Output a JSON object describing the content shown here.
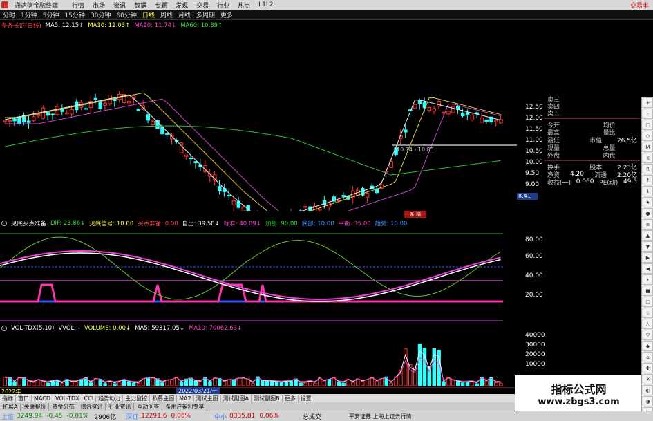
{
  "topbar": {
    "title": "通达信金融终端",
    "menus": [
      "行情",
      "市场",
      "资讯",
      "数据",
      "专题",
      "发现",
      "交易",
      "行业",
      "热点",
      "L1L2"
    ],
    "right": "交易丰"
  },
  "periods": [
    "分时",
    "1分钟",
    "5分钟",
    "15分钟",
    "30分钟",
    "60分钟",
    "日线",
    "周线",
    "月线",
    "多周期",
    "更多"
  ],
  "main_info": {
    "name": "条条长证(日线)",
    "ma5": "MA5: 12.15↓",
    "ma10": "MA10: 12.03↑",
    "ma20": "MA20: 11.74↓",
    "ma60": "MA60: 10.89↑"
  },
  "price_axis": [
    "12.50",
    "12.00",
    "11.50",
    "11.00",
    "10.50",
    "10.00",
    "9.50",
    "9.00"
  ],
  "range_label": "10.74 - 10.85",
  "cursor_price": "8.41",
  "quote": {
    "sell_labels": [
      "卖三",
      "卖四",
      "卖五"
    ],
    "rows": [
      {
        "l": "今开",
        "lv": "",
        "r": "均价",
        "rv": ""
      },
      {
        "l": "最高",
        "lv": "",
        "r": "量比",
        "rv": ""
      },
      {
        "l": "最低",
        "lv": "",
        "r": "市值",
        "rv": "26.5亿"
      },
      {
        "l": "现量",
        "lv": "",
        "r": "总量",
        "rv": ""
      },
      {
        "l": "外盘",
        "lv": "",
        "r": "内盘",
        "rv": ""
      },
      {
        "l": "换手",
        "lv": "",
        "r": "股本",
        "rv": "2.23亿"
      },
      {
        "l": "净资",
        "lv": "4.20",
        "r": "流通",
        "rv": "2.20亿"
      },
      {
        "l": "收益(一)",
        "lv": "0.060",
        "r": "PE(动)",
        "rv": "49.5"
      }
    ]
  },
  "indicator": {
    "name": "见底买点准备",
    "dif": "DIF: 23.86↓",
    "signal": "见底信号: 10.00",
    "buy": "买点准备: 0.00",
    "exit": "自出: 39.58↓",
    "a": "标准: 40.09↓",
    "b": "顶部: 90.00",
    "c": "底部: 10.00",
    "d": "平衡: 35.00",
    "e": "趋势: 10.00",
    "axis": [
      "80.00",
      "60.00",
      "40.00",
      "20.00"
    ],
    "marker": "条 精"
  },
  "volume": {
    "name": "VOL-TDX(5,10)",
    "vvol": "VVOL: -",
    "vol": "VOLUME: 0.00↓",
    "ma5": "MA5: 59317.05↓",
    "ma10": "MA10: 70062.63↓",
    "axis": [
      "40000",
      "30000",
      "20000",
      "10000"
    ],
    "date_tag": "2022/03/21/一",
    "year": "2022年"
  },
  "bottom_tabs": [
    "指标",
    "窗口",
    "MACD",
    "VOL-TDX",
    "CCI",
    "趋势动力",
    "主力监控",
    "私募主图",
    "MA2",
    "测试主图",
    "测试副图A",
    "测试副图B",
    "更多",
    "设置"
  ],
  "bottom_tabs2": [
    "扩展A",
    "关联报价",
    "资金分布",
    "综合资讯",
    "行业资讯",
    "互动问答",
    "条用户福利专享"
  ],
  "status": {
    "sh_label": "上证",
    "sh_val": "3249.94",
    "sh_chg": "-0.45",
    "sh_pct": "-0.01%",
    "sh_amt": "2906亿",
    "sz_label": "深证",
    "sz_val": "12291.6",
    "sz_pct": "0.06%",
    "zx_label": "中小",
    "zx_val": "8335.81",
    "zx_pct": "0.06%",
    "total": "总成交",
    "broker": "平安证券 上海上证云行情"
  },
  "watermark": {
    "line1": "指标公式网",
    "line2": "www.zbgs3.com"
  },
  "right_tools": [
    "+",
    "-",
    "□",
    "◇",
    "M",
    "K",
    "R",
    "↑",
    "↓",
    "★",
    "●",
    "≡",
    "▲",
    "▼",
    "▶",
    "◀",
    "•",
    "■",
    "□",
    "☆",
    "△",
    "▽",
    "◆",
    "⌂",
    "✚",
    "✕",
    "◐",
    "◑",
    "✉",
    "☰"
  ],
  "colors": {
    "up": "#ff3333",
    "down": "#33ffff",
    "ma5": "#ffffff",
    "ma10": "#ffff44",
    "ma20": "#ff44cc",
    "ma60": "#33cc33"
  }
}
